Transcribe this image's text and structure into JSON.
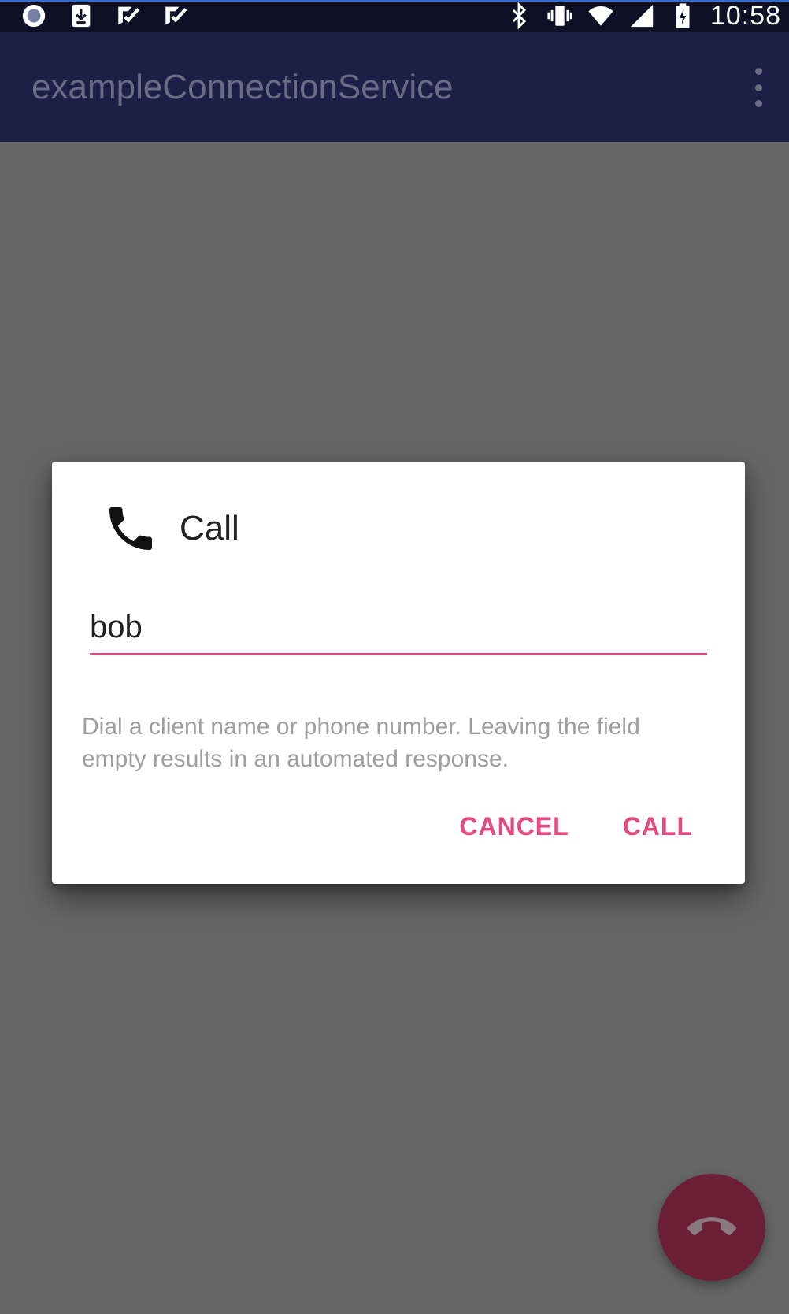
{
  "status_bar": {
    "time": "10:58",
    "left_icons": [
      "record-icon",
      "download-icon",
      "check-notification-icon",
      "check-notification-icon"
    ],
    "right_icons": [
      "bluetooth-icon",
      "vibrate-icon",
      "wifi-icon",
      "cellular-icon",
      "battery-charging-icon"
    ]
  },
  "app_bar": {
    "title": "exampleConnectionService",
    "menu_icon": "more-vert-icon"
  },
  "dialog": {
    "icon": "phone-icon",
    "title": "Call",
    "input": {
      "value": "bob",
      "placeholder": ""
    },
    "helper_text": "Dial a client name or phone number. Leaving the field empty results in an automated response.",
    "cancel_label": "CANCEL",
    "call_label": "CALL"
  },
  "fab": {
    "icon": "call-end-icon"
  },
  "colors": {
    "accent": "#e5497e",
    "primary_dark": "#0f1026",
    "primary_dimmed": "#1c1f46",
    "scrim": "#666666",
    "fab": "#6a1f37"
  }
}
